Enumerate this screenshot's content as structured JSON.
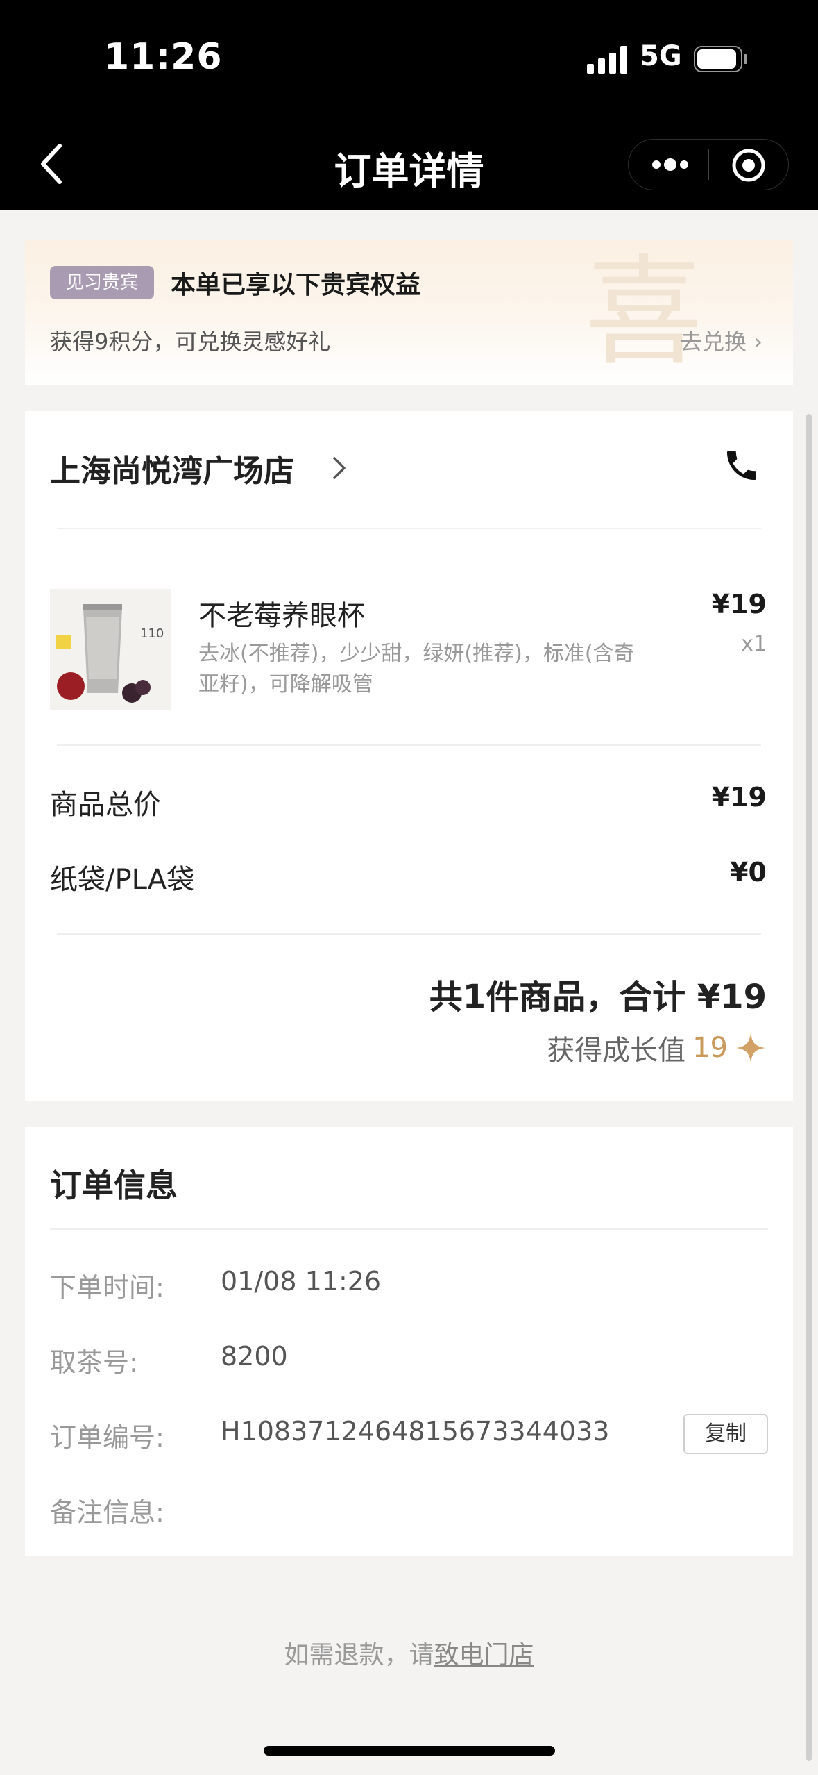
{
  "status_bar": {
    "time": "11:26",
    "network": "5G"
  },
  "navbar": {
    "title": "订单详情"
  },
  "vip": {
    "badge": "见习贵宾",
    "title": "本单已享以下贵宾权益",
    "subtitle": "获得9积分，可兑换灵感好礼",
    "link": "去兑换 ›",
    "watermark": "喜"
  },
  "store": {
    "name": "上海尚悦湾广场店"
  },
  "item": {
    "name": "不老莓养眼杯",
    "specs": "去冰(不推荐)，少少甜，绿妍(推荐)，标准(含奇亚籽)，可降解吸管",
    "price": "¥19",
    "qty": "x1",
    "thumb_text": "110"
  },
  "costs": [
    {
      "label": "商品总价",
      "value": "¥19"
    },
    {
      "label": "纸袋/PLA袋",
      "value": "¥0"
    }
  ],
  "summary": {
    "total": "共1件商品，合计 ¥19",
    "growth_label": "获得成长值",
    "growth_value": "19"
  },
  "order_info": {
    "title": "订单信息",
    "rows": [
      {
        "label": "下单时间:",
        "value": "01/08 11:26"
      },
      {
        "label": "取茶号:",
        "value": "8200"
      },
      {
        "label": "订单编号:",
        "value": "H1083712464815673344033"
      },
      {
        "label": "备注信息:",
        "value": ""
      }
    ],
    "copy_label": "复制"
  },
  "refund": {
    "prefix": "如需退款，请",
    "link": "致电门店"
  },
  "colors": {
    "accent_gold": "#c99a5c",
    "badge_purple": "#a89bb2",
    "nav_bg": "#000000"
  }
}
